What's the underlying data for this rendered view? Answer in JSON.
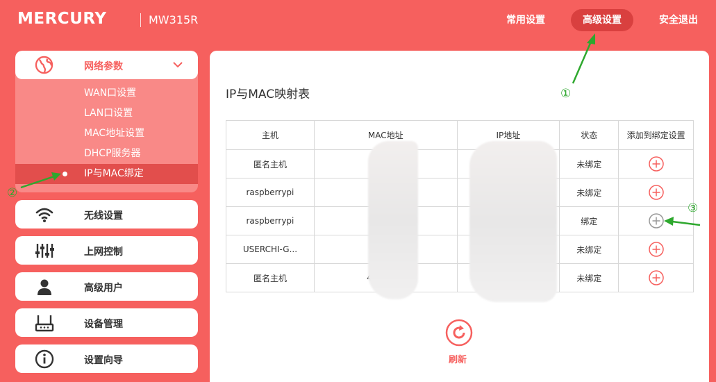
{
  "header": {
    "brand": "MERCURY",
    "model": "MW315R",
    "nav": [
      "常用设置",
      "高级设置",
      "安全退出"
    ]
  },
  "sidebar": {
    "group_label": "网络参数",
    "sub_items": [
      "WAN口设置",
      "LAN口设置",
      "MAC地址设置",
      "DHCP服务器",
      "IP与MAC绑定"
    ],
    "buttons": [
      "无线设置",
      "上网控制",
      "高级用户",
      "设备管理",
      "设置向导"
    ]
  },
  "main": {
    "title": "IP与MAC映射表",
    "columns": [
      "主机",
      "MAC地址",
      "IP地址",
      "状态",
      "添加到绑定设置"
    ],
    "rows": [
      {
        "host": "匿名主机",
        "mac": "74-1                01",
        "ip": "",
        "status": "未绑定"
      },
      {
        "host": "raspberrypi",
        "mac": "B8-                E",
        "ip": "",
        "status": "未绑定"
      },
      {
        "host": "raspberrypi",
        "mac": "B8-                E",
        "ip": "",
        "status": "绑定"
      },
      {
        "host": "USERCHI-G...",
        "mac": "B8-E                C",
        "ip": "",
        "status": "未绑定"
      },
      {
        "host": "匿名主机",
        "mac": "40-B4              72",
        "ip": "",
        "status": "未绑定"
      }
    ],
    "refresh_label": "刷新"
  },
  "annotations": [
    "①",
    "②",
    "③"
  ],
  "colors": {
    "brand_red": "#f6605e",
    "active_nav": "#d9403f",
    "submenu_bg": "#f98987",
    "submenu_active": "#e24e4c",
    "annotation_green": "#2ea82e"
  }
}
